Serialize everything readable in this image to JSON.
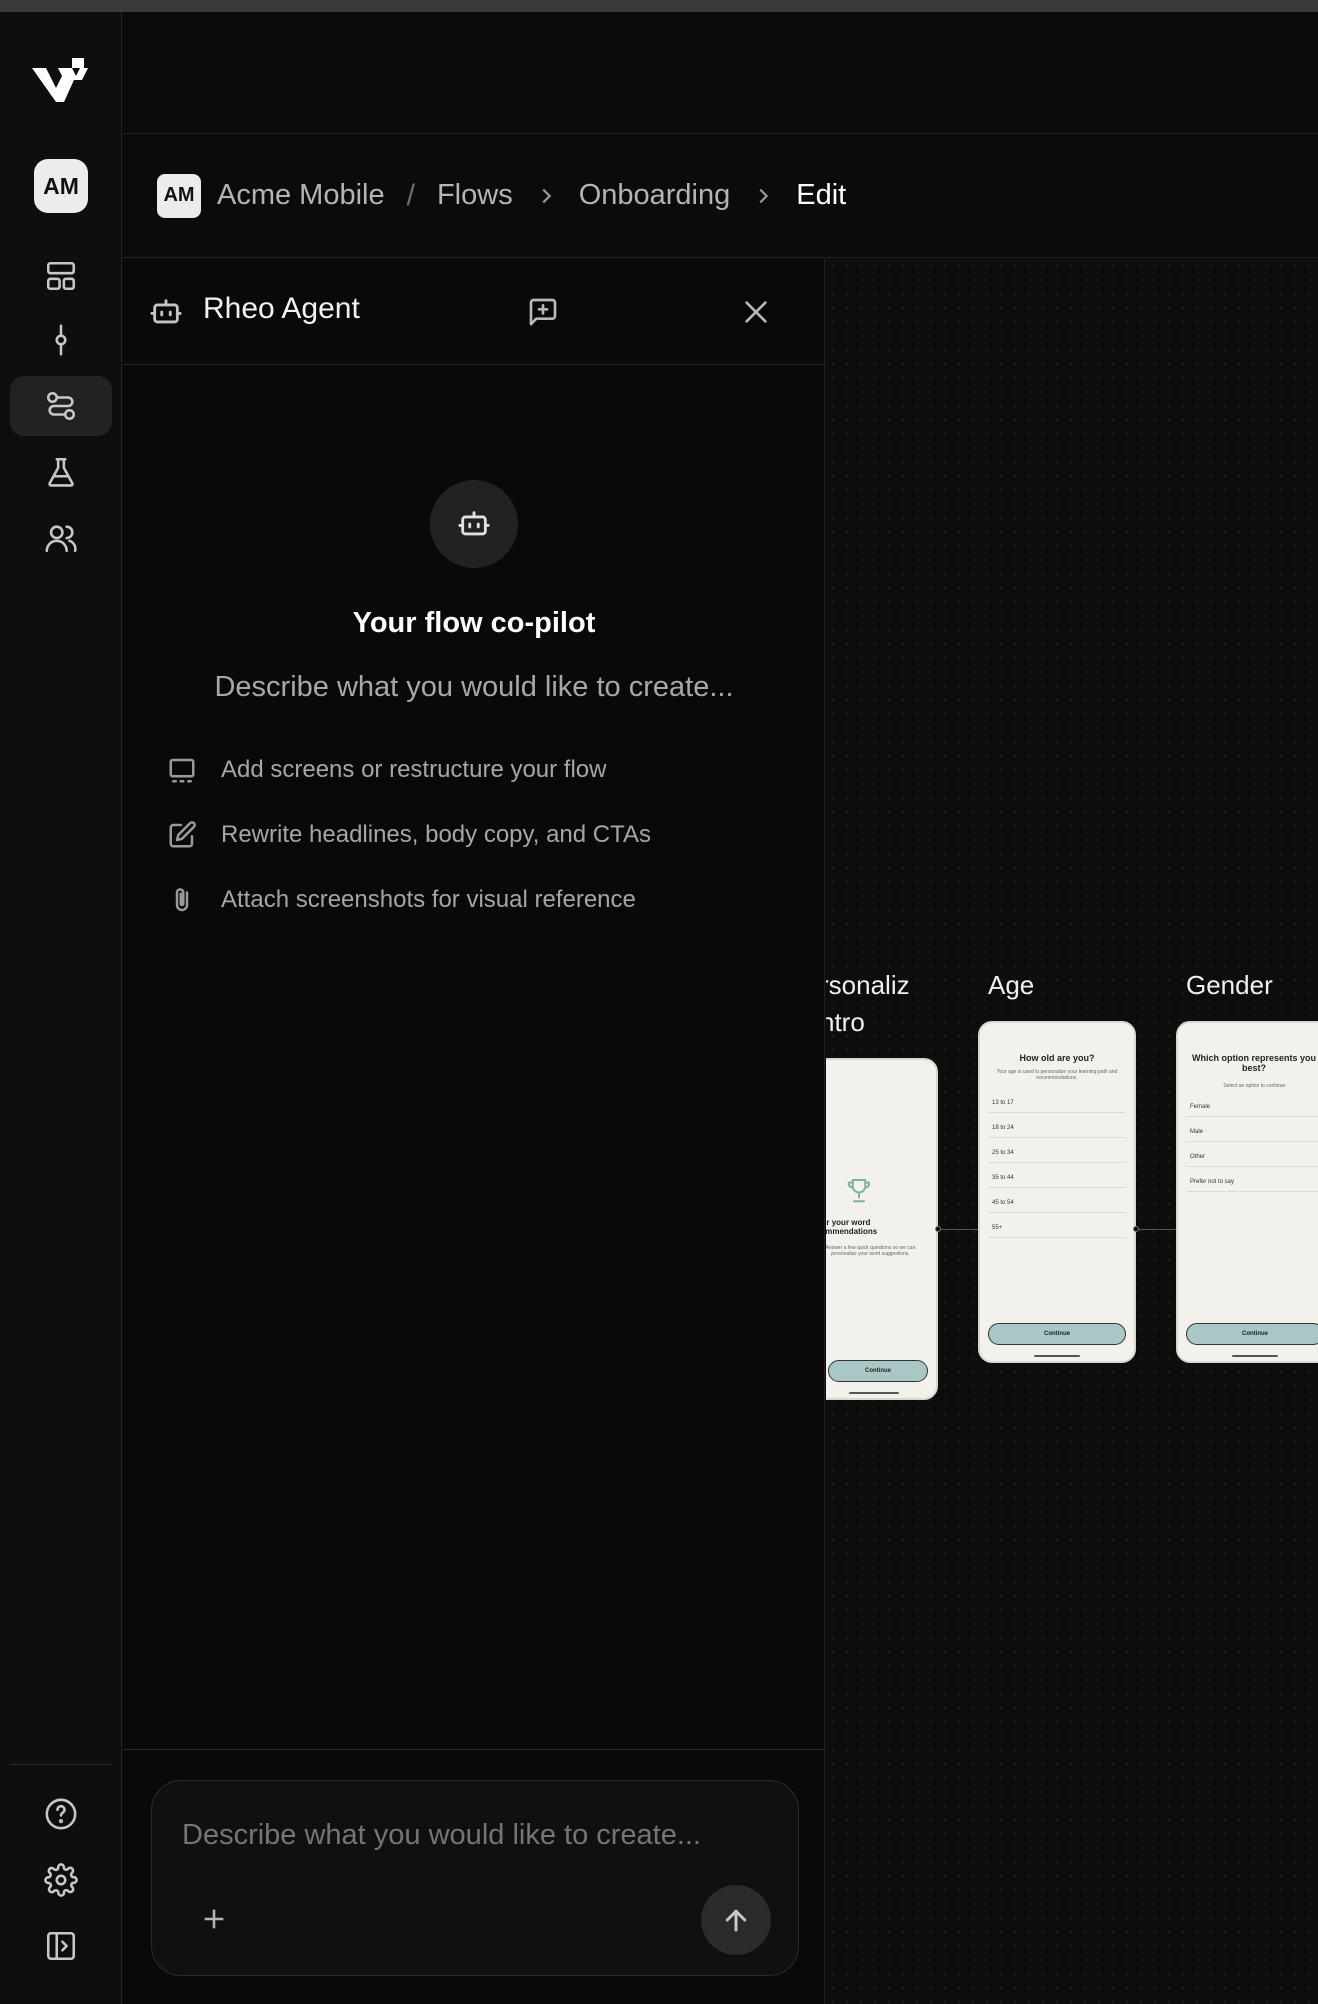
{
  "app": {
    "rail": {
      "avatar_initials": "AM",
      "icons": [
        "logo-icon",
        "dashboard-icon",
        "commit-icon",
        "flows-icon",
        "experiments-icon",
        "users-icon",
        "help-icon",
        "settings-icon",
        "collapse-sidebar-icon"
      ],
      "active_item": "flows"
    },
    "breadcrumb": {
      "avatar_initials": "AM",
      "workspace": "Acme Mobile",
      "separator": "/",
      "section": "Flows",
      "flow": "Onboarding",
      "current": "Edit"
    },
    "agent_panel": {
      "title": "Rheo Agent",
      "hero_title": "Your flow co-pilot",
      "hero_subtitle": "Describe what you would like to create...",
      "tips": [
        {
          "icon": "screen-icon",
          "label": "Add screens or restructure your flow"
        },
        {
          "icon": "edit-icon",
          "label": "Rewrite headlines, body copy, and CTAs"
        },
        {
          "icon": "paperclip-icon",
          "label": "Attach screenshots for visual reference"
        }
      ],
      "composer": {
        "placeholder": "Describe what you would like to create..."
      }
    },
    "canvas": {
      "screens": [
        {
          "label_line1": "rsonaliz",
          "label_line2": "ntro",
          "headline": "Tailor your word recommendations",
          "body": "Answer a few quick questions so we can personalize your word suggestions.",
          "cta": "Continue"
        },
        {
          "label": "Age",
          "headline": "How old are you?",
          "body": "Your age is used to personalize your learning path and recommendations.",
          "options": [
            "13 to 17",
            "18 to 24",
            "25 to 34",
            "35 to 44",
            "45 to 54",
            "55+"
          ],
          "cta": "Continue"
        },
        {
          "label": "Gender",
          "headline": "Which option represents you best?",
          "body": "Select an option to continue.",
          "options": [
            "Female",
            "Male",
            "Other",
            "Prefer not to say"
          ],
          "cta": "Continue"
        }
      ]
    },
    "colors": {
      "background": "#0b0b0b",
      "panel": "#090909",
      "accent_cta": "#a9c7c4",
      "phone_bg": "#f3f1ec"
    }
  }
}
